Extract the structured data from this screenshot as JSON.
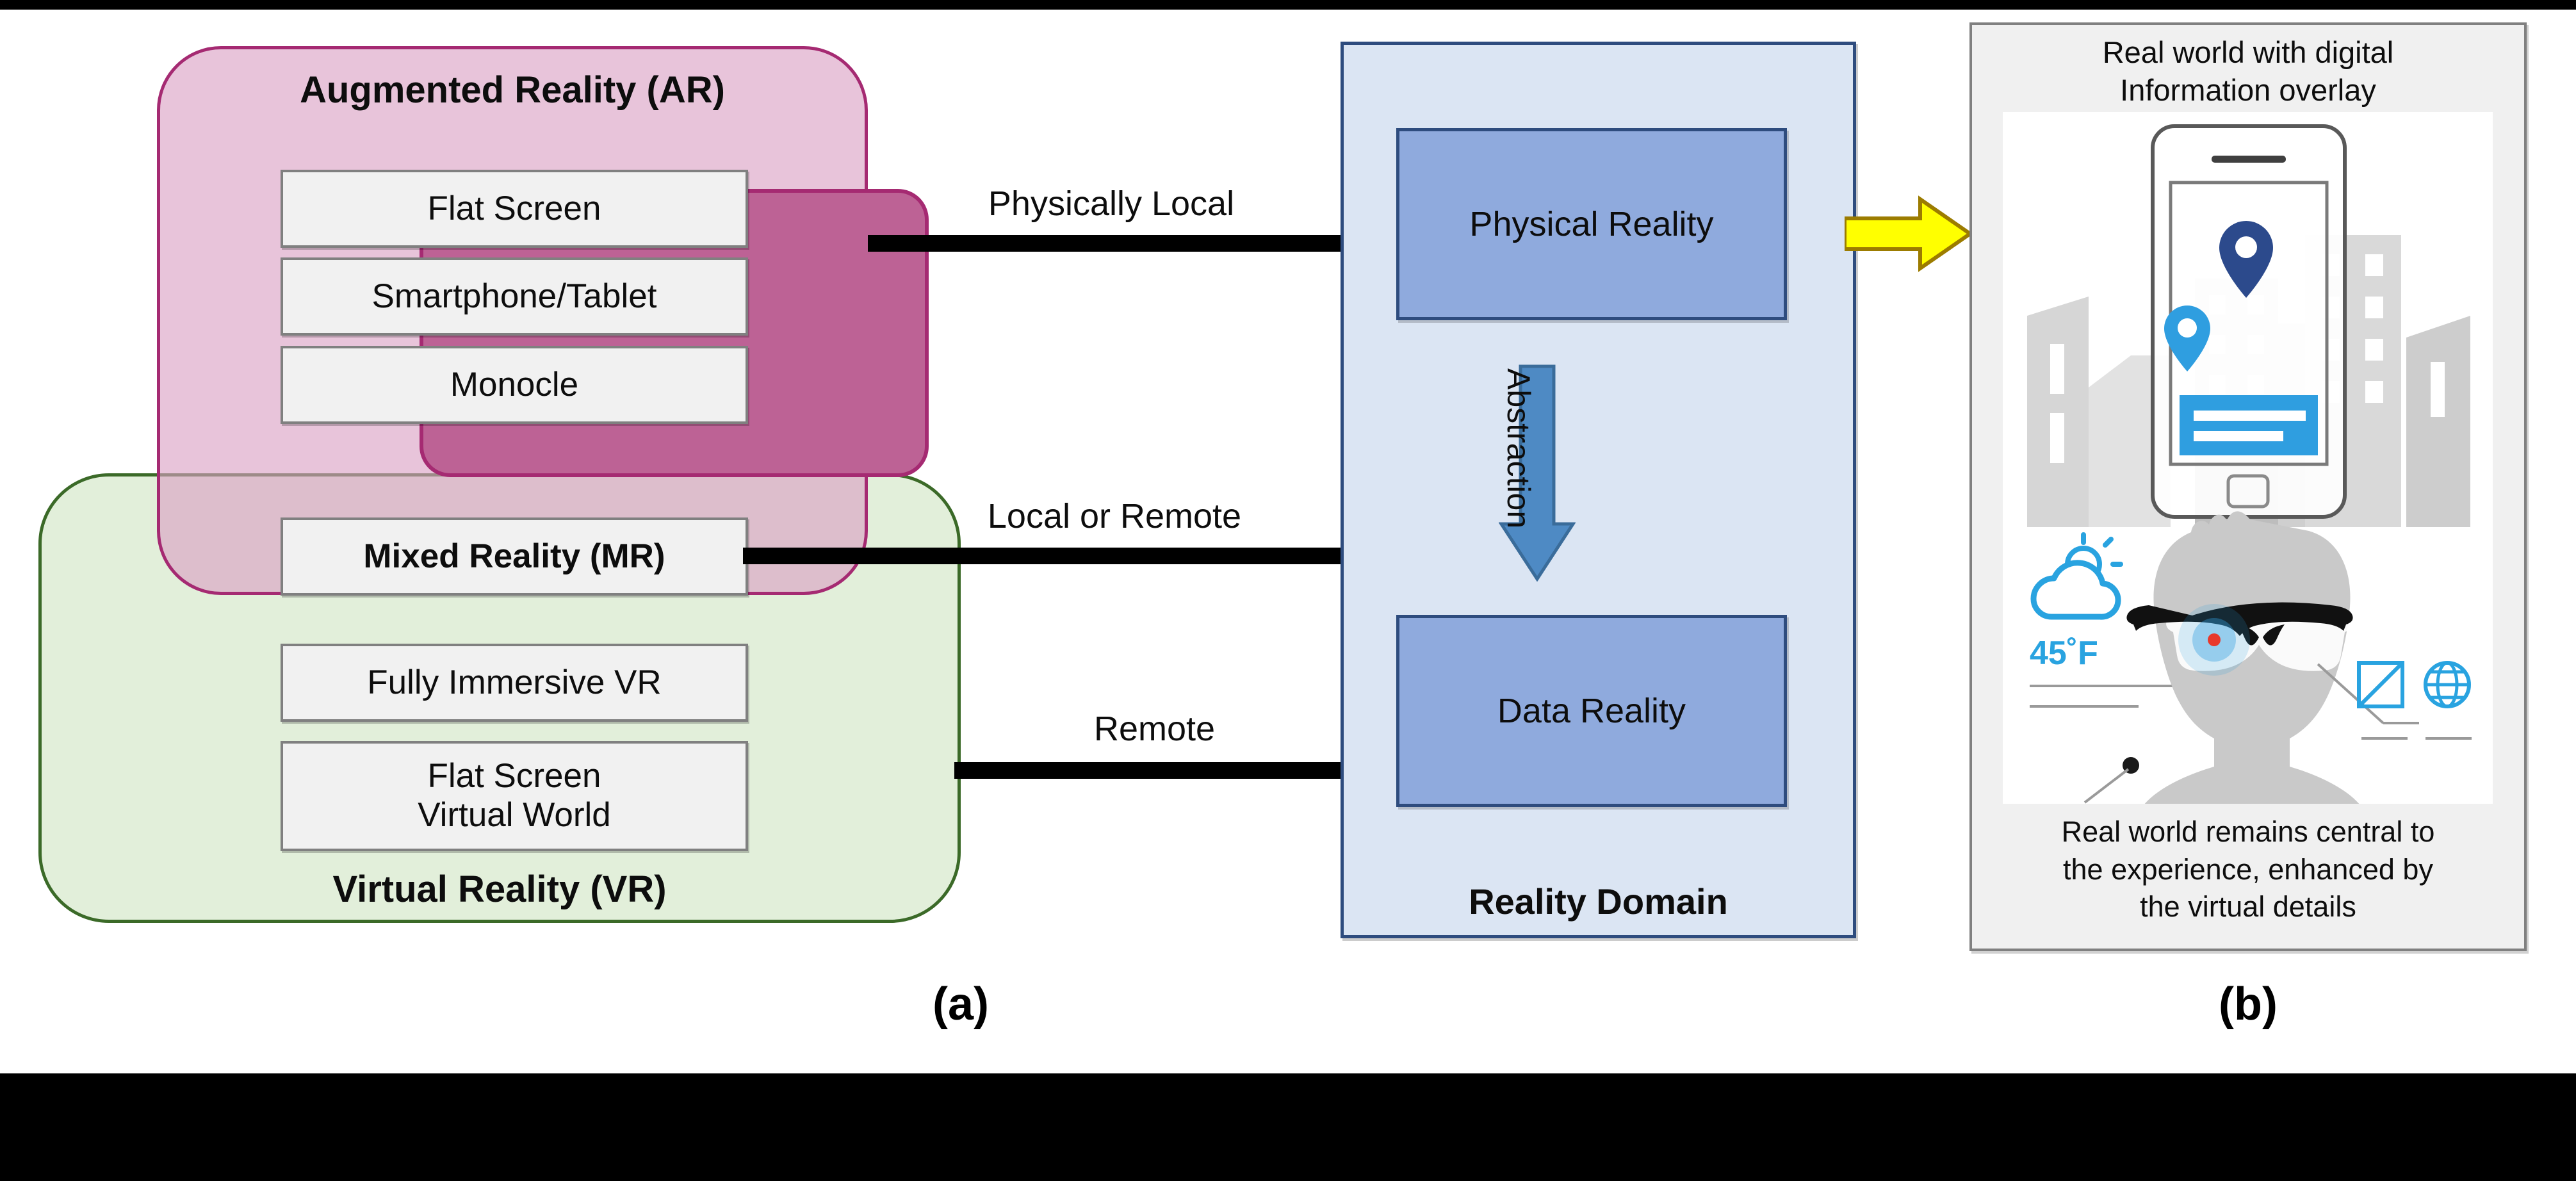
{
  "figure": {
    "panel_a_letter": "(a)",
    "panel_b_letter": "(b)"
  },
  "panel_a": {
    "ar_group": {
      "title": "Augmented Reality (AR)",
      "fill_color": "#daa0c4",
      "border_color": "#a52a72",
      "inner_fill": "#bd6295",
      "items": [
        {
          "label": "Flat Screen"
        },
        {
          "label": "Smartphone/Tablet"
        },
        {
          "label": "Monocle"
        }
      ]
    },
    "vr_group": {
      "title": "Virtual Reality (VR)",
      "fill_color": "#e2efda",
      "border_color": "#3b6a28",
      "items": [
        {
          "label": "Fully Immersive VR"
        },
        {
          "label": "Flat Screen\nVirtual World"
        }
      ]
    },
    "shared_item": {
      "label": "Mixed Reality (MR)"
    },
    "connectors": [
      {
        "label": "Physically Local",
        "from": "Augmented Reality (AR)",
        "to": "Physical Reality"
      },
      {
        "label": "Local or Remote",
        "from": "Mixed Reality (MR)",
        "to": "Physical Reality"
      },
      {
        "label": "Remote",
        "from": "Virtual Reality (VR)",
        "to": "Data Reality"
      }
    ],
    "reality_domain": {
      "title": "Reality Domain",
      "fill_color": "#dbe5f3",
      "border_color": "#2e4c7e",
      "block_fill": "#8faadd",
      "blocks": [
        {
          "label": "Physical Reality"
        },
        {
          "label": "Data Reality"
        }
      ],
      "abstraction_label": "Abstraction",
      "abstraction_arrow_color": "#4e8ac4"
    },
    "output_arrow": {
      "color": "#ffff00",
      "border_color": "#9c7c00"
    }
  },
  "panel_b": {
    "caption_top": "Real world with digital\nInformation overlay",
    "caption_bottom": "Real world remains central to\nthe experience, enhanced by\nthe virtual details",
    "weather_widget": {
      "temperature": "45˚F",
      "icon": "cloud-sun-icon"
    },
    "panel_fill": "#f0f0f0",
    "accent_color": "#29a3e0",
    "pin_dark_color": "#2c4a8c",
    "pin_light_color": "#2f9ee0",
    "icons": [
      "smartphone-icon",
      "building-icon",
      "map-pin-icon",
      "ar-glasses-icon",
      "person-head-icon",
      "image-placeholder-icon",
      "globe-icon",
      "cloud-sun-icon"
    ]
  }
}
